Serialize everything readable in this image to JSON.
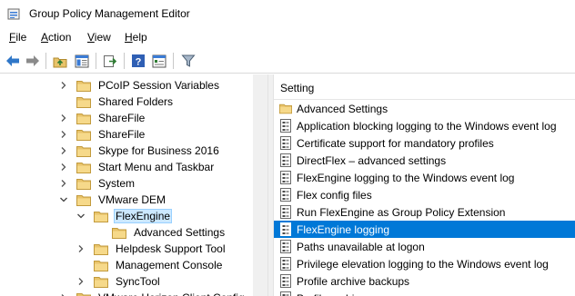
{
  "window": {
    "title": "Group Policy Management Editor"
  },
  "menu": [
    "File",
    "Action",
    "View",
    "Help"
  ],
  "toolbar": {
    "icons": [
      "back-icon",
      "forward-icon",
      "up-folder-icon",
      "show-hide-tree-icon",
      "export-list-icon",
      "help-icon",
      "properties-icon",
      "filter-icon"
    ]
  },
  "tree": {
    "items": [
      {
        "label": "PCoIP Session Variables",
        "expand": "collapsed",
        "depth": 0
      },
      {
        "label": "Shared Folders",
        "expand": "none",
        "depth": 0
      },
      {
        "label": "ShareFile",
        "expand": "collapsed",
        "depth": 0
      },
      {
        "label": "ShareFile",
        "expand": "collapsed",
        "depth": 0
      },
      {
        "label": "Skype for Business 2016",
        "expand": "collapsed",
        "depth": 0
      },
      {
        "label": "Start Menu and Taskbar",
        "expand": "collapsed",
        "depth": 0
      },
      {
        "label": "System",
        "expand": "collapsed",
        "depth": 0
      },
      {
        "label": "VMware DEM",
        "expand": "expanded",
        "depth": 0
      },
      {
        "label": "FlexEngine",
        "expand": "expanded",
        "depth": 1,
        "selected": true
      },
      {
        "label": "Advanced Settings",
        "expand": "none",
        "depth": 2
      },
      {
        "label": "Helpdesk Support Tool",
        "expand": "collapsed",
        "depth": 1
      },
      {
        "label": "Management Console",
        "expand": "none",
        "depth": 1
      },
      {
        "label": "SyncTool",
        "expand": "collapsed",
        "depth": 1
      },
      {
        "label": "VMware Horizon Client Config",
        "expand": "collapsed",
        "depth": 0
      }
    ]
  },
  "list": {
    "header": "Setting",
    "items": [
      {
        "label": "Advanced Settings",
        "kind": "folder"
      },
      {
        "label": "Application blocking logging to the Windows event log",
        "kind": "setting"
      },
      {
        "label": "Certificate support for mandatory profiles",
        "kind": "setting"
      },
      {
        "label": "DirectFlex – advanced settings",
        "kind": "setting"
      },
      {
        "label": "FlexEngine logging to the Windows event log",
        "kind": "setting"
      },
      {
        "label": "Flex config files",
        "kind": "setting"
      },
      {
        "label": "Run FlexEngine as Group Policy Extension",
        "kind": "setting"
      },
      {
        "label": "FlexEngine logging",
        "kind": "setting",
        "selected": true
      },
      {
        "label": "Paths unavailable at logon",
        "kind": "setting"
      },
      {
        "label": "Privilege elevation logging to the Windows event log",
        "kind": "setting"
      },
      {
        "label": "Profile archive backups",
        "kind": "setting"
      },
      {
        "label": "Profile archives",
        "kind": "setting"
      }
    ]
  },
  "colors": {
    "selection": "#0078d7",
    "tree_selection": "#cce8ff",
    "folder": "#e8c36a"
  }
}
